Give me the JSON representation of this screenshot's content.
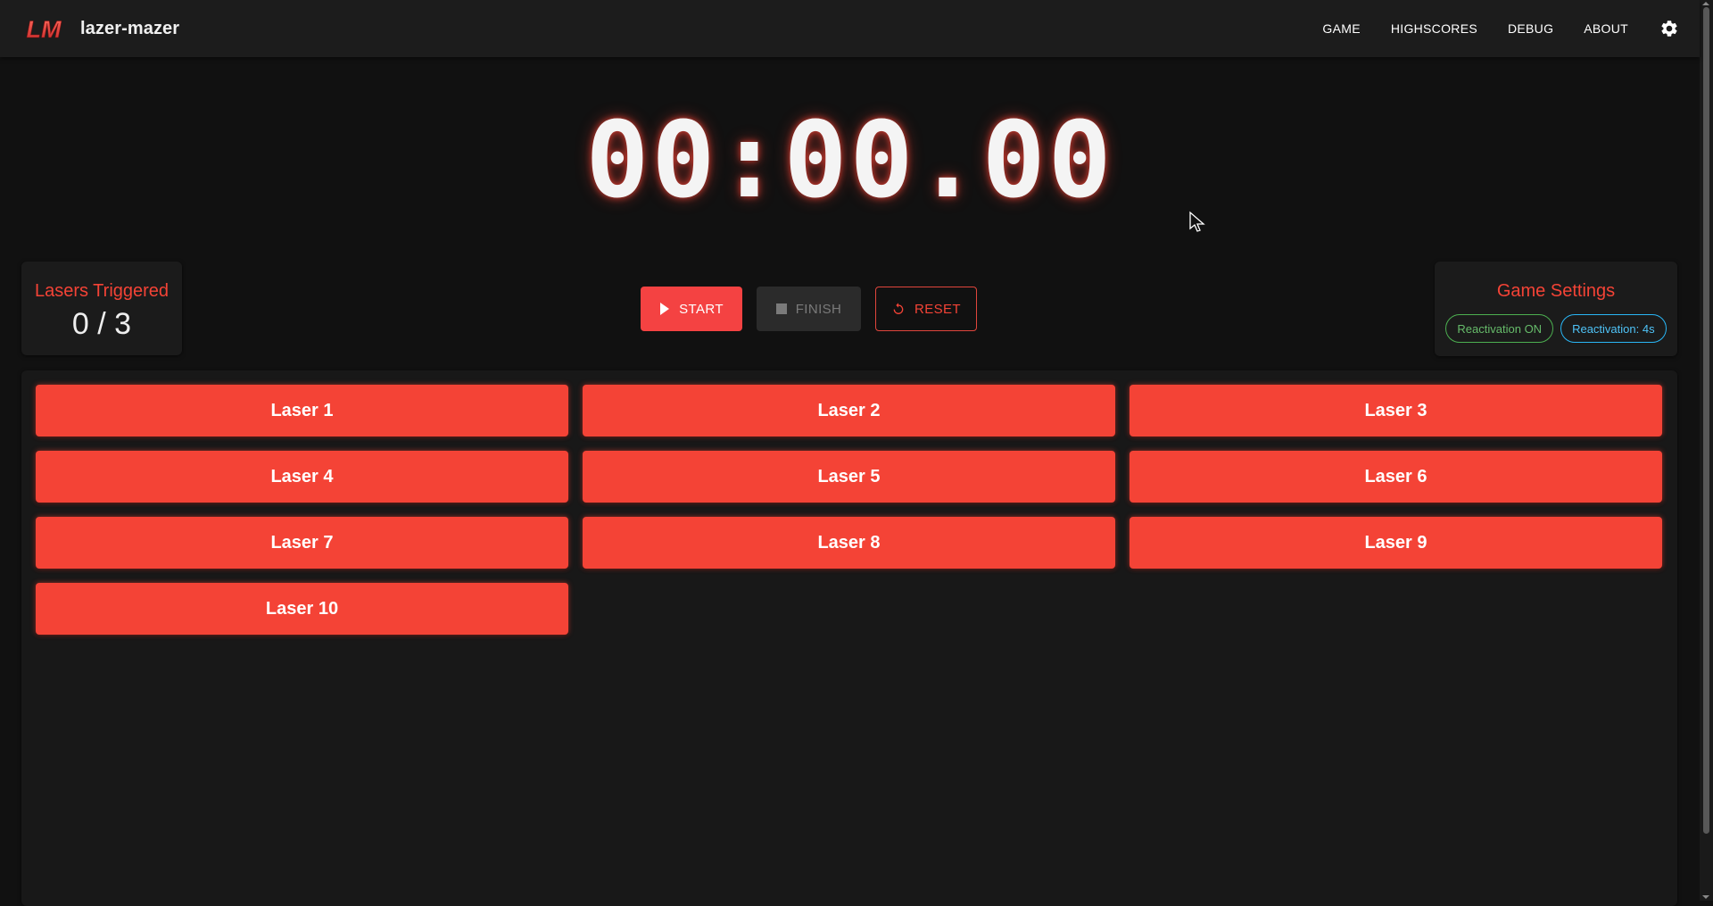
{
  "app": {
    "logo_text": "LM",
    "name": "lazer-mazer"
  },
  "nav": {
    "items": [
      "GAME",
      "HIGHSCORES",
      "DEBUG",
      "ABOUT"
    ],
    "settings_icon": "gear-icon"
  },
  "timer": {
    "display": "00:00.00"
  },
  "triggered": {
    "title": "Lasers Triggered",
    "count": "0 / 3"
  },
  "controls": {
    "start_label": "START",
    "start_icon": "play-icon",
    "finish_label": "FINISH",
    "finish_icon": "stop-icon",
    "finish_disabled": true,
    "reset_label": "RESET",
    "reset_icon": "refresh-icon"
  },
  "settings": {
    "title": "Game Settings",
    "chips": [
      "Reactivation ON",
      "Reactivation: 4s"
    ]
  },
  "lasers": [
    "Laser 1",
    "Laser 2",
    "Laser 3",
    "Laser 4",
    "Laser 5",
    "Laser 6",
    "Laser 7",
    "Laser 8",
    "Laser 9",
    "Laser 10"
  ],
  "colors": {
    "accent": "#f44336",
    "background": "#111111",
    "appbar": "#1c1c1c",
    "chip_green": "#66bb6a",
    "chip_blue": "#4fc3f7"
  }
}
